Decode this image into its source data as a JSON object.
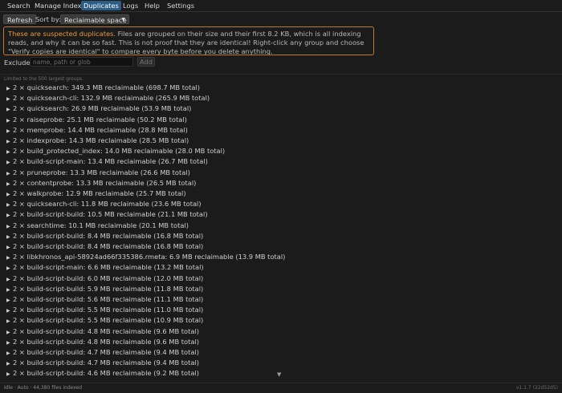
{
  "menu": {
    "items": [
      "Search",
      "Manage Index",
      "Duplicates",
      "Logs",
      "Help",
      "Settings"
    ],
    "active": "Duplicates"
  },
  "toolbar": {
    "refresh_label": "Refresh",
    "sort_label": "Sort by:",
    "sort_value": "Reclaimable space",
    "sort_icon": "triangle-down"
  },
  "warning": {
    "emphasis": "These are suspected duplicates.",
    "text": " Files are grouped on their size and their first 8.2 KB, which is all indexing reads, and why it can be so fast. This is not proof that they are identical! Right-click any group and choose \"Verify copies are identical\" to compare every byte before you delete anything.",
    "border_color": "#c07a2e"
  },
  "exclude": {
    "label": "Exclude:",
    "placeholder": "name, path or glob",
    "value": "",
    "add_label": "Add"
  },
  "limit_note": "Limited to the 500 largest groups.",
  "groups": [
    "2 × quicksearch: 349.3 MB reclaimable (698.7 MB total)",
    "2 × quicksearch-cli: 132.9 MB reclaimable (265.9 MB total)",
    "2 × quicksearch: 26.9 MB reclaimable (53.9 MB total)",
    "2 × raiseprobe: 25.1 MB reclaimable (50.2 MB total)",
    "2 × memprobe: 14.4 MB reclaimable (28.8 MB total)",
    "2 × indexprobe: 14.3 MB reclaimable (28.5 MB total)",
    "2 × build_protected_index: 14.0 MB reclaimable (28.0 MB total)",
    "2 × build-script-main: 13.4 MB reclaimable (26.7 MB total)",
    "2 × pruneprobe: 13.3 MB reclaimable (26.6 MB total)",
    "2 × contentprobe: 13.3 MB reclaimable (26.5 MB total)",
    "2 × walkprobe: 12.9 MB reclaimable (25.7 MB total)",
    "2 × quicksearch-cli: 11.8 MB reclaimable (23.6 MB total)",
    "2 × build-script-build: 10.5 MB reclaimable (21.1 MB total)",
    "2 × searchtime: 10.1 MB reclaimable (20.1 MB total)",
    "2 × build-script-build: 8.4 MB reclaimable (16.8 MB total)",
    "2 × build-script-build: 8.4 MB reclaimable (16.8 MB total)",
    "2 × libkhronos_api-58924ad66f335386.rmeta: 6.9 MB reclaimable (13.9 MB total)",
    "2 × build-script-main: 6.6 MB reclaimable (13.2 MB total)",
    "2 × build-script-build: 6.0 MB reclaimable (12.0 MB total)",
    "2 × build-script-build: 5.9 MB reclaimable (11.8 MB total)",
    "2 × build-script-build: 5.6 MB reclaimable (11.1 MB total)",
    "2 × build-script-build: 5.5 MB reclaimable (11.0 MB total)",
    "2 × build-script-build: 5.5 MB reclaimable (10.9 MB total)",
    "2 × build-script-build: 4.8 MB reclaimable (9.6 MB total)",
    "2 × build-script-build: 4.8 MB reclaimable (9.6 MB total)",
    "2 × build-script-build: 4.7 MB reclaimable (9.4 MB total)",
    "2 × build-script-build: 4.7 MB reclaimable (9.4 MB total)",
    "2 × build-script-build: 4.6 MB reclaimable (9.2 MB total)"
  ],
  "status": {
    "left": "Idle · Auto · 44,380 files indexed",
    "right": "v1.1.7 (22d52d5)"
  }
}
